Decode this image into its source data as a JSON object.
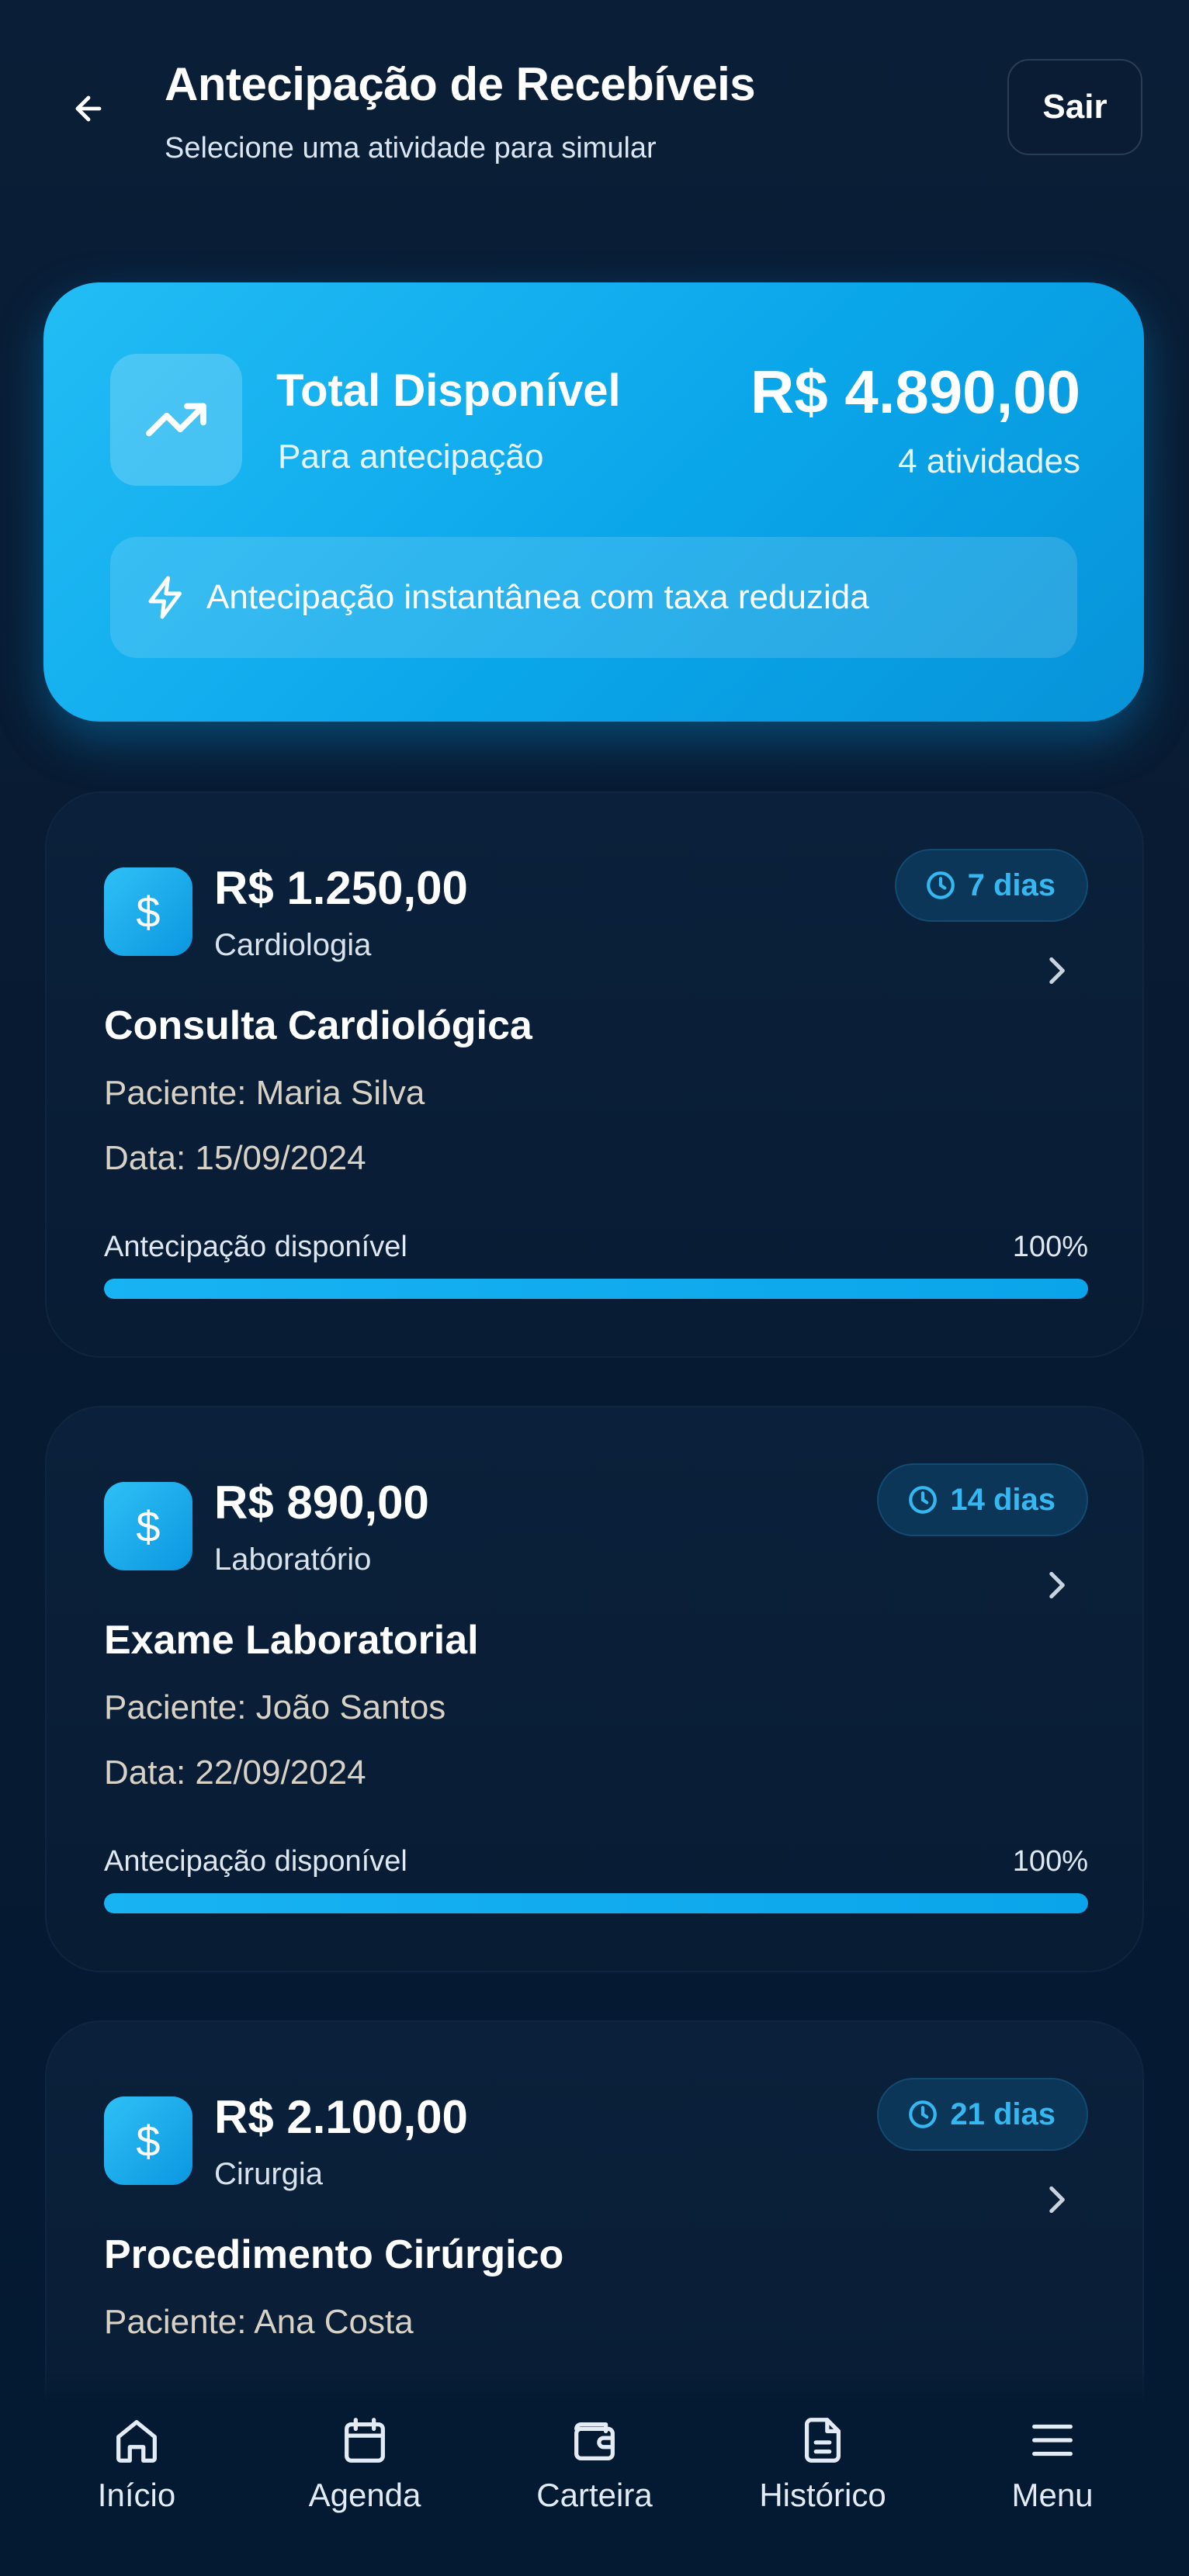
{
  "header": {
    "title": "Antecipação de Recebíveis",
    "subtitle": "Selecione uma atividade para simular",
    "logout_label": "Sair"
  },
  "summary": {
    "title": "Total Disponível",
    "subtitle": "Para antecipação",
    "amount": "R$ 4.890,00",
    "count": "4 atividades",
    "banner": "Antecipação instantânea com taxa reduzida"
  },
  "cards": [
    {
      "amount": "R$ 1.250,00",
      "category": "Cardiologia",
      "badge": "7 dias",
      "title": "Consulta Cardiológica",
      "patient": "Paciente: Maria Silva",
      "date": "Data: 15/09/2024",
      "progress_label": "Antecipação disponível",
      "progress_value": "100%",
      "progress": 1.0
    },
    {
      "amount": "R$ 890,00",
      "category": "Laboratório",
      "badge": "14 dias",
      "title": "Exame Laboratorial",
      "patient": "Paciente: João Santos",
      "date": "Data: 22/09/2024",
      "progress_label": "Antecipação disponível",
      "progress_value": "100%",
      "progress": 1.0
    },
    {
      "amount": "R$ 2.100,00",
      "category": "Cirurgia",
      "badge": "21 dias",
      "title": "Procedimento Cirúrgico",
      "patient": "Paciente: Ana Costa"
    }
  ],
  "nav": {
    "items": [
      {
        "label": "Início",
        "icon": "home-icon"
      },
      {
        "label": "Agenda",
        "icon": "calendar-icon"
      },
      {
        "label": "Carteira",
        "icon": "wallet-icon"
      },
      {
        "label": "Histórico",
        "icon": "document-icon"
      },
      {
        "label": "Menu",
        "icon": "menu-icon"
      }
    ]
  },
  "colors": {
    "background": "#041a32",
    "accent": "#0aa6ea",
    "badge_text": "#35b8f1"
  }
}
